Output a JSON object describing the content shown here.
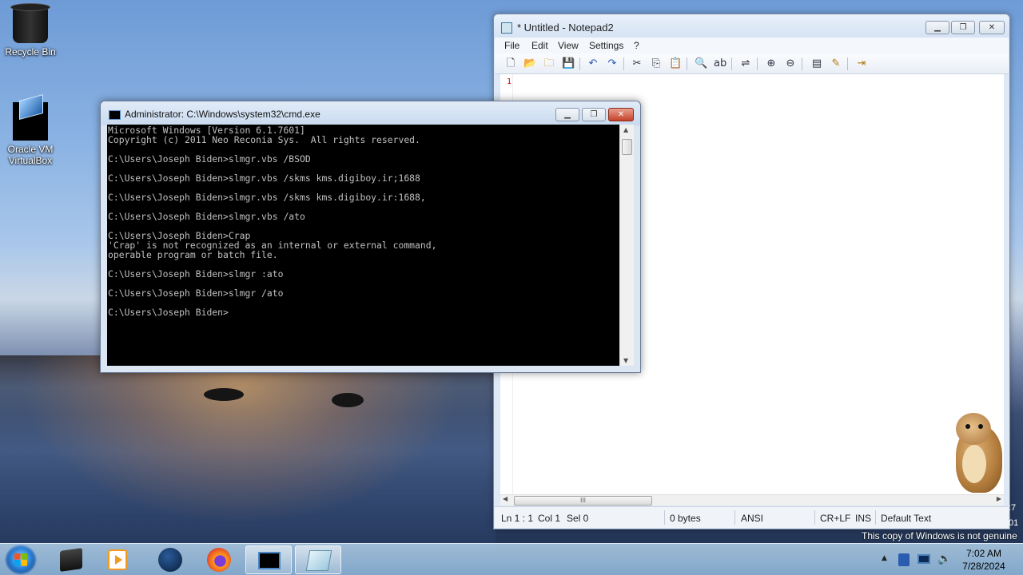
{
  "desktop": {
    "icons": [
      {
        "label": "Recycle Bin",
        "icon": "recycle-bin-icon"
      },
      {
        "label": "Oracle VM VirtualBox",
        "icon": "virtualbox-icon"
      }
    ],
    "watermark": "This copy of Windows is not genuine",
    "edge_fragments": [
      ":7",
      "01"
    ]
  },
  "notepad": {
    "title": "* Untitled - Notepad2",
    "menu": [
      "File",
      "Edit",
      "View",
      "Settings",
      "?"
    ],
    "line_number": "1",
    "status": {
      "position": "Ln 1 : 1",
      "col": "Col 1",
      "sel": "Sel 0",
      "size": "0 bytes",
      "encoding": "ANSI",
      "eol": "CR+LF",
      "mode": "INS",
      "scheme": "Default Text"
    },
    "scroll_grip": "III"
  },
  "cmd": {
    "title": "Administrator: C:\\Windows\\system32\\cmd.exe",
    "lines": [
      "Microsoft Windows [Version 6.1.7601]",
      "Copyright (c) 2011 Neo Reconia Sys.  All rights reserved.",
      "",
      "C:\\Users\\Joseph Biden>slmgr.vbs /BSOD",
      "",
      "C:\\Users\\Joseph Biden>slmgr.vbs /skms kms.digiboy.ir;1688",
      "",
      "C:\\Users\\Joseph Biden>slmgr.vbs /skms kms.digiboy.ir:1688,",
      "",
      "C:\\Users\\Joseph Biden>slmgr.vbs /ato",
      "",
      "C:\\Users\\Joseph Biden>Crap",
      "'Crap' is not recognized as an internal or external command,",
      "operable program or batch file.",
      "",
      "C:\\Users\\Joseph Biden>slmgr :ato",
      "",
      "C:\\Users\\Joseph Biden>slmgr /ato",
      "",
      "C:\\Users\\Joseph Biden>"
    ]
  },
  "taskbar": {
    "apps": [
      {
        "name": "explorer",
        "icon": "file-explorer-icon"
      },
      {
        "name": "media-player",
        "icon": "media-player-icon"
      },
      {
        "name": "globe",
        "icon": "globe-icon"
      },
      {
        "name": "firefox",
        "icon": "firefox-icon"
      },
      {
        "name": "cmd",
        "icon": "cmd-icon",
        "active": true
      },
      {
        "name": "notepad2",
        "icon": "notepad-icon",
        "active": true
      }
    ],
    "clock": {
      "time": "7:02 AM",
      "date": "7/28/2024"
    },
    "tray_icons": [
      "show-hidden-icons-arrow",
      "action-center-icon",
      "network-icon",
      "volume-icon"
    ]
  },
  "colors": {
    "console_bg": "#000000",
    "console_fg": "#c0c0c0",
    "close_button": "#c5422a",
    "line_number": "#dd0000"
  }
}
